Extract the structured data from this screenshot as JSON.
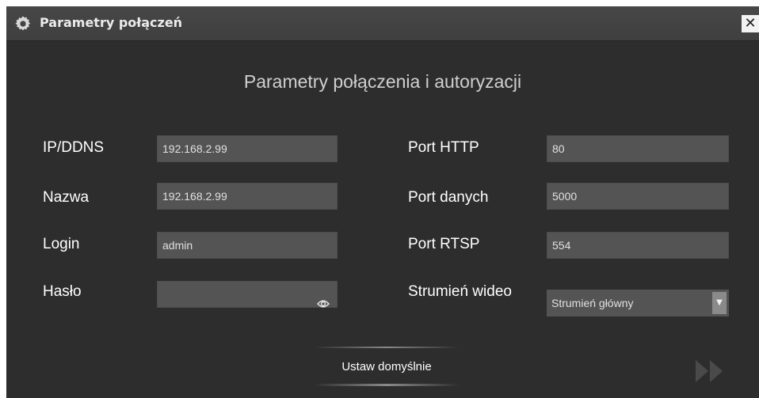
{
  "window": {
    "title": "Parametry połączeń",
    "close_label": "✕",
    "icon": "gear-icon"
  },
  "heading": "Parametry połączenia i autoryzacji",
  "left_fields": {
    "ip": {
      "label": "IP/DDNS",
      "value": "192.168.2.99"
    },
    "name": {
      "label": "Nazwa",
      "value": "192.168.2.99"
    },
    "login": {
      "label": "Login",
      "value": "admin"
    },
    "password": {
      "label": "Hasło",
      "value": "",
      "icon": "eye-icon"
    }
  },
  "right_fields": {
    "port_http": {
      "label": "Port HTTP",
      "value": "80"
    },
    "port_data": {
      "label": "Port danych",
      "value": "5000"
    },
    "port_rtsp": {
      "label": "Port RTSP",
      "value": "554"
    },
    "video_stream": {
      "label": "Strumień wideo",
      "selected": "Strumień główny",
      "icon": "chevron-down-icon"
    }
  },
  "buttons": {
    "defaults_label": "Ustaw domyślnie",
    "next_icon": "double-chevron-right-icon"
  },
  "colors": {
    "background": "#2d2d2d",
    "titlebar": "#434343",
    "field": "#545454",
    "text": "#ffffff"
  }
}
